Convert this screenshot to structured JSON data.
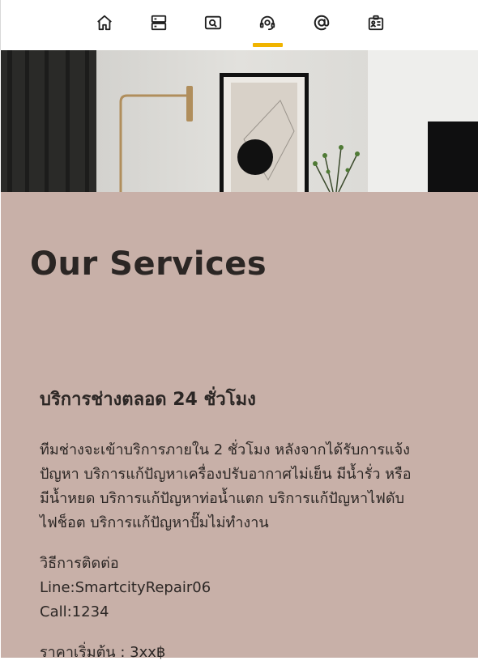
{
  "nav": {
    "items": [
      {
        "icon": "home-icon"
      },
      {
        "icon": "server-icon"
      },
      {
        "icon": "search-window-icon"
      },
      {
        "icon": "support-agent-icon",
        "active": true
      },
      {
        "icon": "at-sign-icon"
      },
      {
        "icon": "contact-card-icon"
      }
    ],
    "active_color": "#f0b400"
  },
  "section": {
    "title": "Our Services",
    "background": "#c8b0a8"
  },
  "service": {
    "title": "บริการช่างตลอด 24 ชั่วโมง",
    "description_lines": [
      "ทีมช่างจะเข้าบริการภายใน 2 ชั่วโมง หลังจากได้รับการแจ้ง",
      "ปัญหา บริการแก้ปัญหาเครื่องปรับอากาศไม่เย็น มีน้ำรั่ว หรือ",
      "มีน้ำหยด บริการแก้ปัญหาท่อน้ำแตก บริการแก้ปัญหาไฟดับ",
      "ไฟช็อต บริการแก้ปัญหาปั๊มไม่ทำงาน"
    ],
    "contact_heading": "วิธีการติดต่อ",
    "line": "Line:SmartcityRepair06",
    "call": "Call:1234",
    "price": "ราคาเริ่มต้น : 3xx฿"
  }
}
